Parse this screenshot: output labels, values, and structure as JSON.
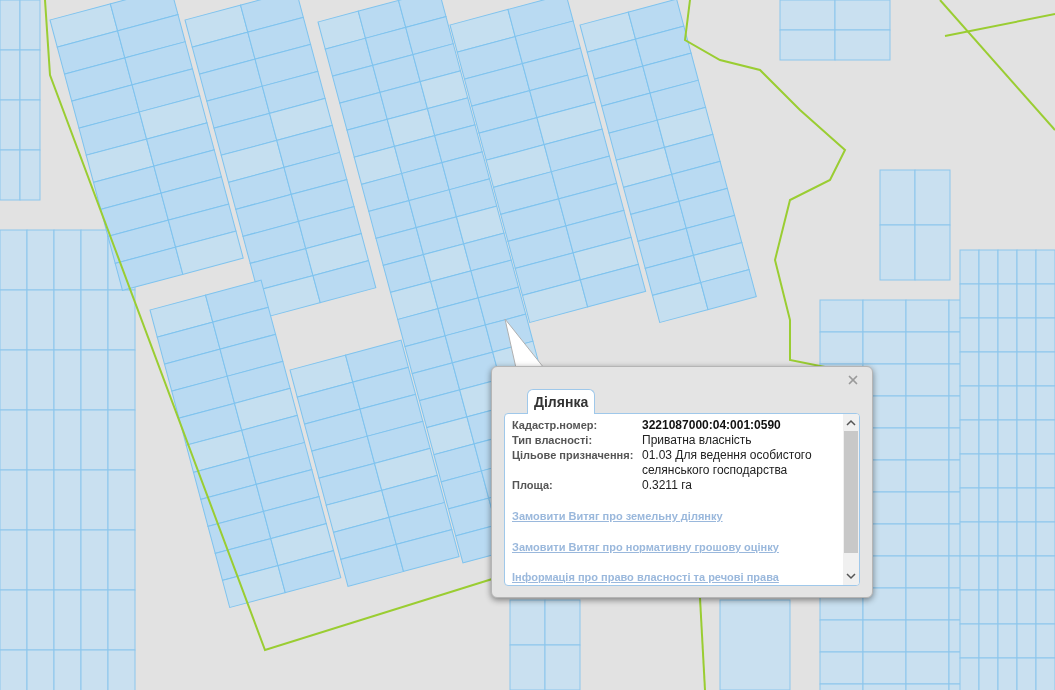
{
  "popup": {
    "tabs": [
      {
        "label": "Ділянка",
        "selected": true
      }
    ],
    "fields": [
      {
        "label": "Кадастр.номер:",
        "value": "3221087000:04:001:0590",
        "kind": "strong"
      },
      {
        "label": "Тип власності:",
        "value": "Приватна власність",
        "kind": "plain"
      },
      {
        "label": "Цільове призначення:",
        "value": "01.03 Для ведення особистого селянського господарства",
        "kind": "plain"
      },
      {
        "label": "Площа:",
        "value": "0.3211 га",
        "kind": "plain"
      }
    ],
    "links": [
      "Замовити Витяг про земельну ділянку",
      "Замовити Витяг про нормативну грошову оцінку",
      "Інформація про право власності та речові права"
    ]
  }
}
